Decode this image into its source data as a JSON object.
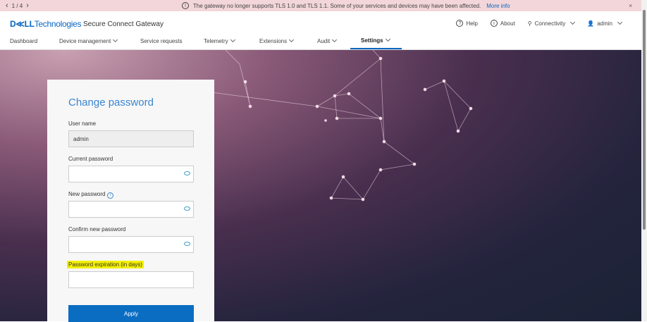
{
  "banner": {
    "pager": "1 / 4",
    "message": "The gateway no longer supports TLS 1.0 and TLS 1.1. Some of your services and devices may have been affected.",
    "link": "More info",
    "close": "×"
  },
  "header": {
    "logo_bold": "D≪LL",
    "logo_rest": "Technologies",
    "app": "Secure Connect Gateway",
    "help": "Help",
    "about": "About",
    "connectivity": "Connectivity",
    "user": "admin"
  },
  "nav": {
    "items": [
      "Dashboard",
      "Device management",
      "Service requests",
      "Telemetry",
      "Extensions",
      "Audit",
      "Settings"
    ]
  },
  "form": {
    "title": "Change password",
    "username_label": "User name",
    "username_value": "admin",
    "current_label": "Current password",
    "new_label": "New password",
    "confirm_label": "Confirm new password",
    "expiration_label": "Password expiration (in days)",
    "apply": "Apply"
  }
}
